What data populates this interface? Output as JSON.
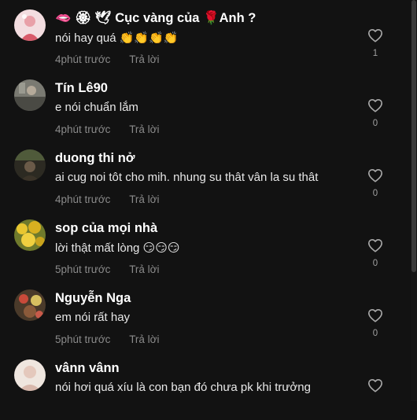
{
  "comments": [
    {
      "name": "🫦 🏵 🕊 Cục vàng của 🌹Anh ?",
      "text": "nói hay quá 👏👏👏👏",
      "time": "4phút trước",
      "reply": "Trả lời",
      "likes": "1",
      "avatar": "avatar-pink-photo"
    },
    {
      "name": "Tín Lê90",
      "text": "e nói chuẩn lắm",
      "time": "4phút trước",
      "reply": "Trả lời",
      "likes": "0",
      "avatar": "avatar-grey-photo"
    },
    {
      "name": "duong thi nở",
      "text": "ai cug noi tôt cho mih. nhung su thât vân la su thât",
      "time": "4phút trước",
      "reply": "Trả lời",
      "likes": "0",
      "avatar": "avatar-dark-photo"
    },
    {
      "name": "sop của mọi nhà",
      "text": "lời thật mất lòng 😏😏😏",
      "time": "5phút trước",
      "reply": "Trả lời",
      "likes": "0",
      "avatar": "avatar-yellow-flowers"
    },
    {
      "name": "Nguyễn Nga",
      "text": "em nói rất hay",
      "time": "5phút trước",
      "reply": "Trả lời",
      "likes": "0",
      "avatar": "avatar-flowers-photo"
    },
    {
      "name": "vânn vânn",
      "text": "nói hơi quá xíu là con bạn đó chưa pk khi trưởng",
      "avatar": "avatar-light-photo"
    }
  ],
  "icons": {
    "like": "heart-outline-icon"
  },
  "colors": {
    "background": "#121212",
    "muted": "#8a8a8a"
  }
}
